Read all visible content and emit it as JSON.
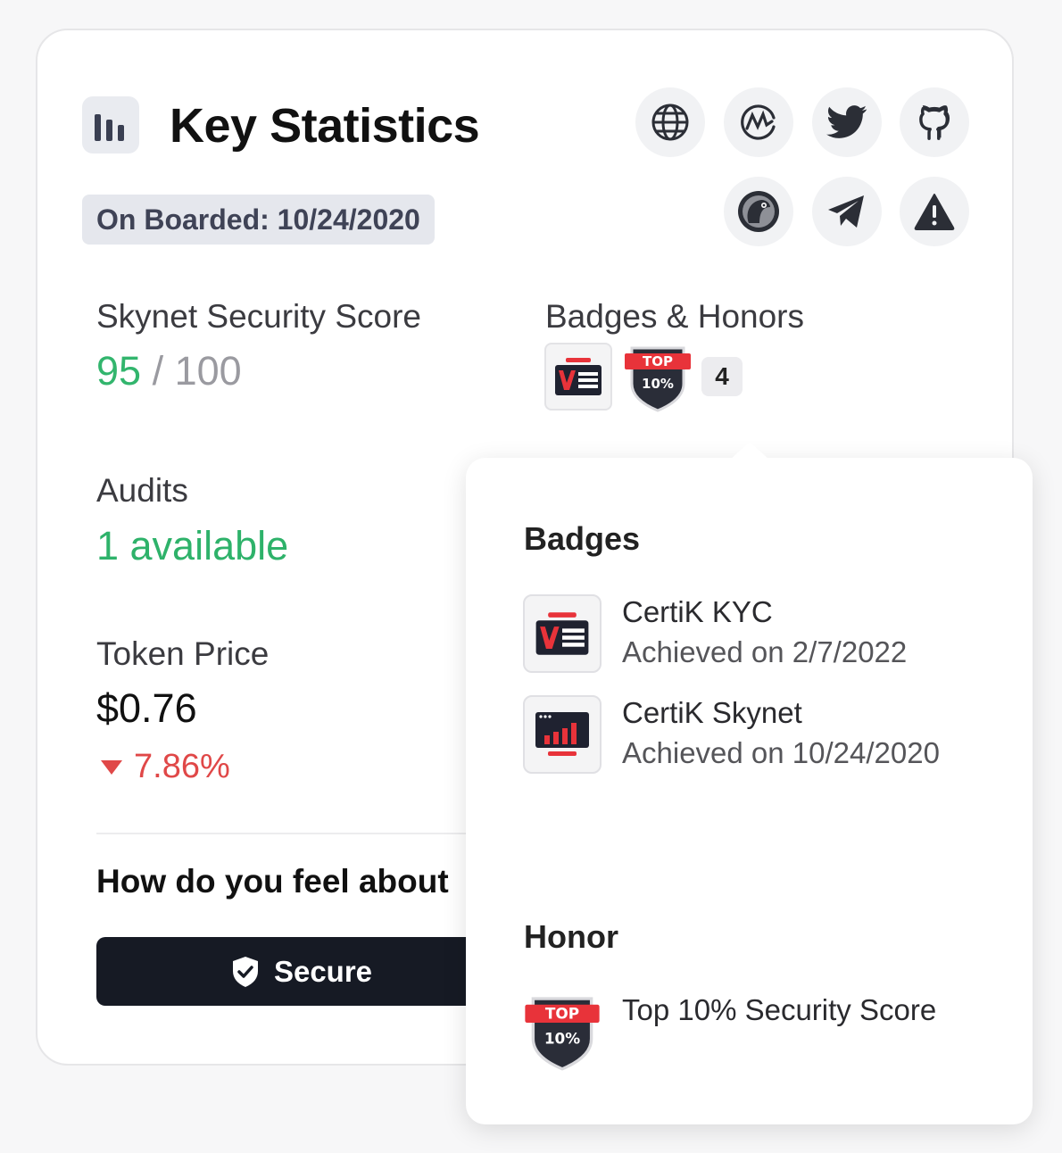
{
  "header": {
    "title": "Key Statistics",
    "onboarded": "On Boarded: 10/24/2020",
    "title_icon": "bar-chart-icon"
  },
  "social_links": [
    {
      "name": "website",
      "icon": "globe-icon"
    },
    {
      "name": "coinmarketcap",
      "icon": "coinmarketcap-icon"
    },
    {
      "name": "twitter",
      "icon": "twitter-icon"
    },
    {
      "name": "github",
      "icon": "github-icon"
    },
    {
      "name": "coingecko",
      "icon": "coingecko-icon"
    },
    {
      "name": "telegram",
      "icon": "telegram-icon"
    },
    {
      "name": "alert",
      "icon": "warning-icon"
    }
  ],
  "score": {
    "label": "Skynet Security Score",
    "value": "95",
    "max": " / 100"
  },
  "audits": {
    "label": "Audits",
    "value": "1 available"
  },
  "token": {
    "label": "Token Price",
    "price": "$0.76",
    "change": "7.86%",
    "change_direction": "down"
  },
  "sentiment": {
    "question": "How do you feel about",
    "secure_label": "Secure"
  },
  "badges_honors": {
    "label": "Badges & Honors",
    "more_count": "4",
    "top_badge_text_top": "TOP",
    "top_badge_text_pct": "10%"
  },
  "popover": {
    "badges_heading": "Badges",
    "badges": [
      {
        "name": "CertiK KYC",
        "date": "Achieved on 2/7/2022",
        "icon": "kyc-badge-icon"
      },
      {
        "name": "CertiK Skynet",
        "date": "Achieved on 10/24/2020",
        "icon": "skynet-badge-icon"
      }
    ],
    "honor_heading": "Honor",
    "honors": [
      {
        "name": "Top 10% Security Score",
        "icon": "top-10-honor-icon"
      }
    ]
  },
  "colors": {
    "green": "#32b56d",
    "red": "#e04848",
    "dark_button": "#161a24",
    "badge_red": "#e8333a"
  }
}
